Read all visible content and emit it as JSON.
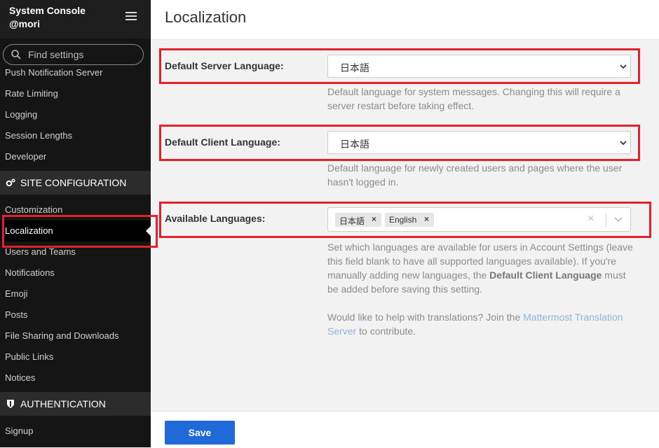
{
  "sidebar": {
    "title": "System Console",
    "user": "@mori",
    "search_placeholder": "Find settings",
    "items_top": [
      "Push Notification Server",
      "Rate Limiting",
      "Logging",
      "Session Lengths",
      "Developer"
    ],
    "section_site": "SITE CONFIGURATION",
    "items_site": [
      "Customization",
      "Localization",
      "Users and Teams",
      "Notifications",
      "Emoji",
      "Posts",
      "File Sharing and Downloads",
      "Public Links",
      "Notices"
    ],
    "section_auth": "AUTHENTICATION",
    "items_auth": [
      "Signup"
    ]
  },
  "page": {
    "title": "Localization",
    "server_lang_label": "Default Server Language:",
    "server_lang_value": "日本語",
    "server_lang_help": "Default language for system messages. Changing this will require a server restart before taking effect.",
    "client_lang_label": "Default Client Language:",
    "client_lang_value": "日本語",
    "client_lang_help": "Default language for newly created users and pages where the user hasn't logged in.",
    "available_label": "Available Languages:",
    "available_values": [
      "日本語",
      "English"
    ],
    "available_help_1": "Set which languages are available for users in Account Settings (leave this field blank to have all supported languages available). If you're manually adding new languages, the ",
    "available_help_bold": "Default Client Language",
    "available_help_2": " must be added before saving this setting.",
    "translate_help_1": "Would like to help with translations? Join the ",
    "translate_link": "Mattermost Translation Server",
    "translate_help_2": " to contribute.",
    "save_label": "Save"
  },
  "colors": {
    "sidebar_bg": "#151515",
    "highlight": "#e3202b",
    "primary_button": "#1f6ad8",
    "link": "#8fb3e2"
  }
}
